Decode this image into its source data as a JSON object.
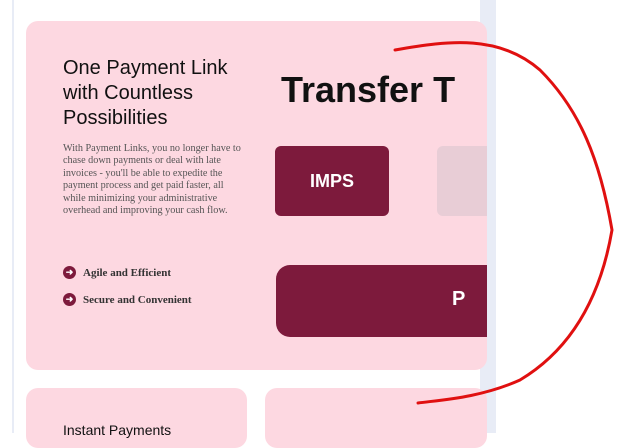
{
  "hero": {
    "title": "One Payment Link with Countless Possibilities",
    "description": "With Payment Links, you no longer have to chase down payments or deal with late invoices - you'll be able to expedite the payment process and get paid faster, all while minimizing your administrative overhead and improving your cash flow.",
    "features": [
      {
        "label": "Agile and Efficient"
      },
      {
        "label": "Secure and Convenient"
      }
    ],
    "transfer_title": "Transfer T",
    "buttons": {
      "imps": "IMPS",
      "big": "P"
    }
  },
  "cards": {
    "instant_payments": "Instant Payments"
  },
  "colors": {
    "accent": "#7d1a3c",
    "card_background": "#fdd8e1",
    "annotation_red": "#e01010"
  }
}
